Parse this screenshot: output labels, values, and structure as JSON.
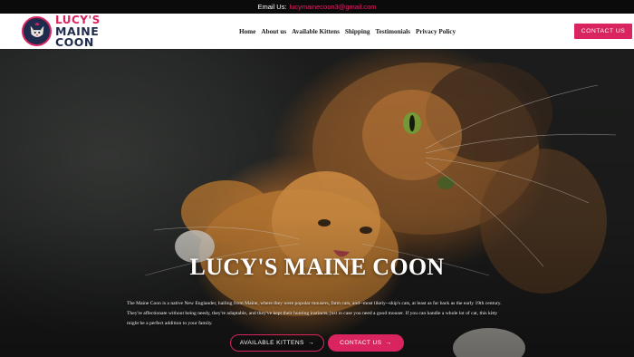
{
  "topbar": {
    "label": "Email Us:",
    "email": "lucymainecoon3@gmail.com"
  },
  "logo": {
    "line1": "LUCY'S",
    "line2": "MAINE COON"
  },
  "nav": {
    "items": [
      {
        "label": "Home"
      },
      {
        "label": "About us"
      },
      {
        "label": "Available Kittens"
      },
      {
        "label": "Shipping"
      },
      {
        "label": "Testimonials"
      },
      {
        "label": "Privacy Policy"
      }
    ]
  },
  "header": {
    "cta_label": "CONTACT US"
  },
  "hero": {
    "title": "LUCY'S MAINE COON",
    "description": "The Maine Coon is a native New Englander, hailing from Maine, where they were popular mousers, farm cats, and--most likely--ship's cats, at least as far back as the early 19th century. They're affectionate without being needy, they're adaptable, and they've kept their hunting instincts, just in case you need a good mouser. If you can handle a whole lot of cat, this kitty might be a perfect addition to your family.",
    "primary_button": "AVAILABLE KITTENS",
    "secondary_button": "CONTACT US",
    "arrow": "→"
  },
  "colors": {
    "accent": "#d9245f",
    "navy": "#1f2b4d",
    "topbar": "#0b0b0b"
  },
  "icons": {
    "logo": "cat-head-icon",
    "button_arrow": "arrow-right-icon"
  }
}
